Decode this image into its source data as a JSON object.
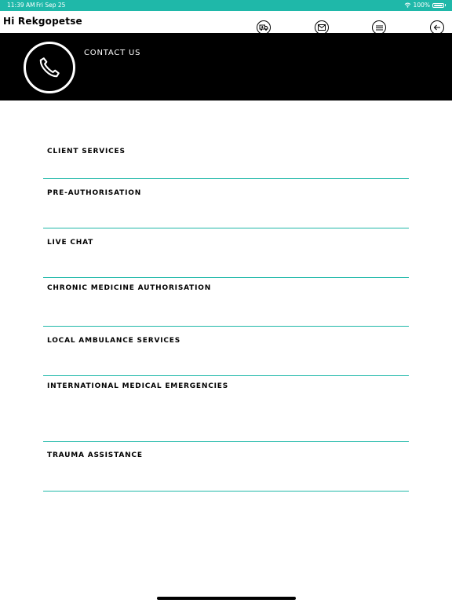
{
  "status_bar": {
    "time": "11:39 AM",
    "date": "Fri Sep 25",
    "battery": "100%"
  },
  "header": {
    "greeting": "Hi Rekgopetse",
    "icons": [
      "ambulance-icon",
      "mail-icon",
      "menu-icon",
      "back-arrow-icon"
    ]
  },
  "banner": {
    "title": "CONTACT US",
    "icon": "phone-icon"
  },
  "colors": {
    "accent": "#1fb8a9",
    "banner_bg": "#000000",
    "text": "#000000"
  },
  "menu": {
    "items": [
      {
        "label": "CLIENT SERVICES"
      },
      {
        "label": "PRE-AUTHORISATION"
      },
      {
        "label": "LIVE CHAT"
      },
      {
        "label": "CHRONIC MEDICINE AUTHORISATION"
      },
      {
        "label": "LOCAL AMBULANCE SERVICES"
      },
      {
        "label": "INTERNATIONAL MEDICAL EMERGENCIES"
      },
      {
        "label": "TRAUMA ASSISTANCE"
      }
    ]
  }
}
